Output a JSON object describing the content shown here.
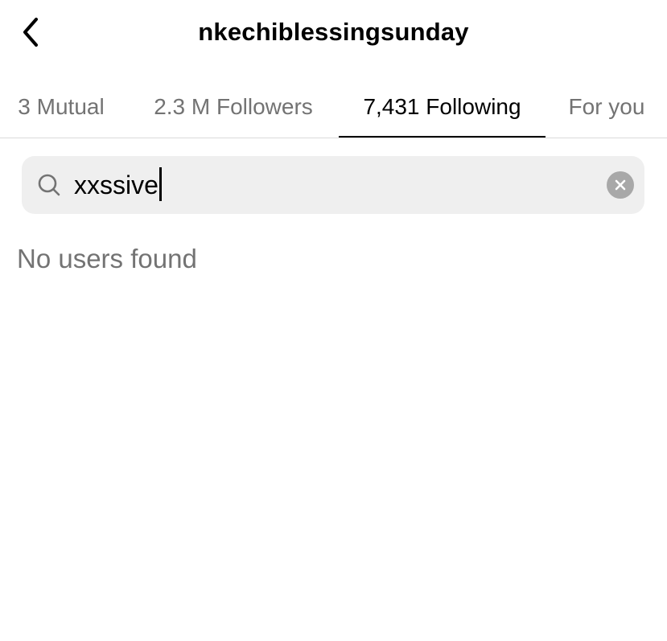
{
  "header": {
    "title": "nkechiblessingsunday",
    "back_icon": "chevron-left-icon"
  },
  "tabs": [
    {
      "label": "3 Mutual",
      "active": false
    },
    {
      "label": "2.3 M Followers",
      "active": false
    },
    {
      "label": "7,431 Following",
      "active": true
    },
    {
      "label": "For you",
      "active": false
    }
  ],
  "search": {
    "value": "xxssive",
    "search_icon": "search-icon",
    "clear_icon": "clear-icon"
  },
  "results": {
    "empty_message": "No users found"
  },
  "colors": {
    "text_primary": "#000000",
    "text_secondary": "#737373",
    "search_background": "#efefef",
    "divider": "#dbdbdb"
  }
}
